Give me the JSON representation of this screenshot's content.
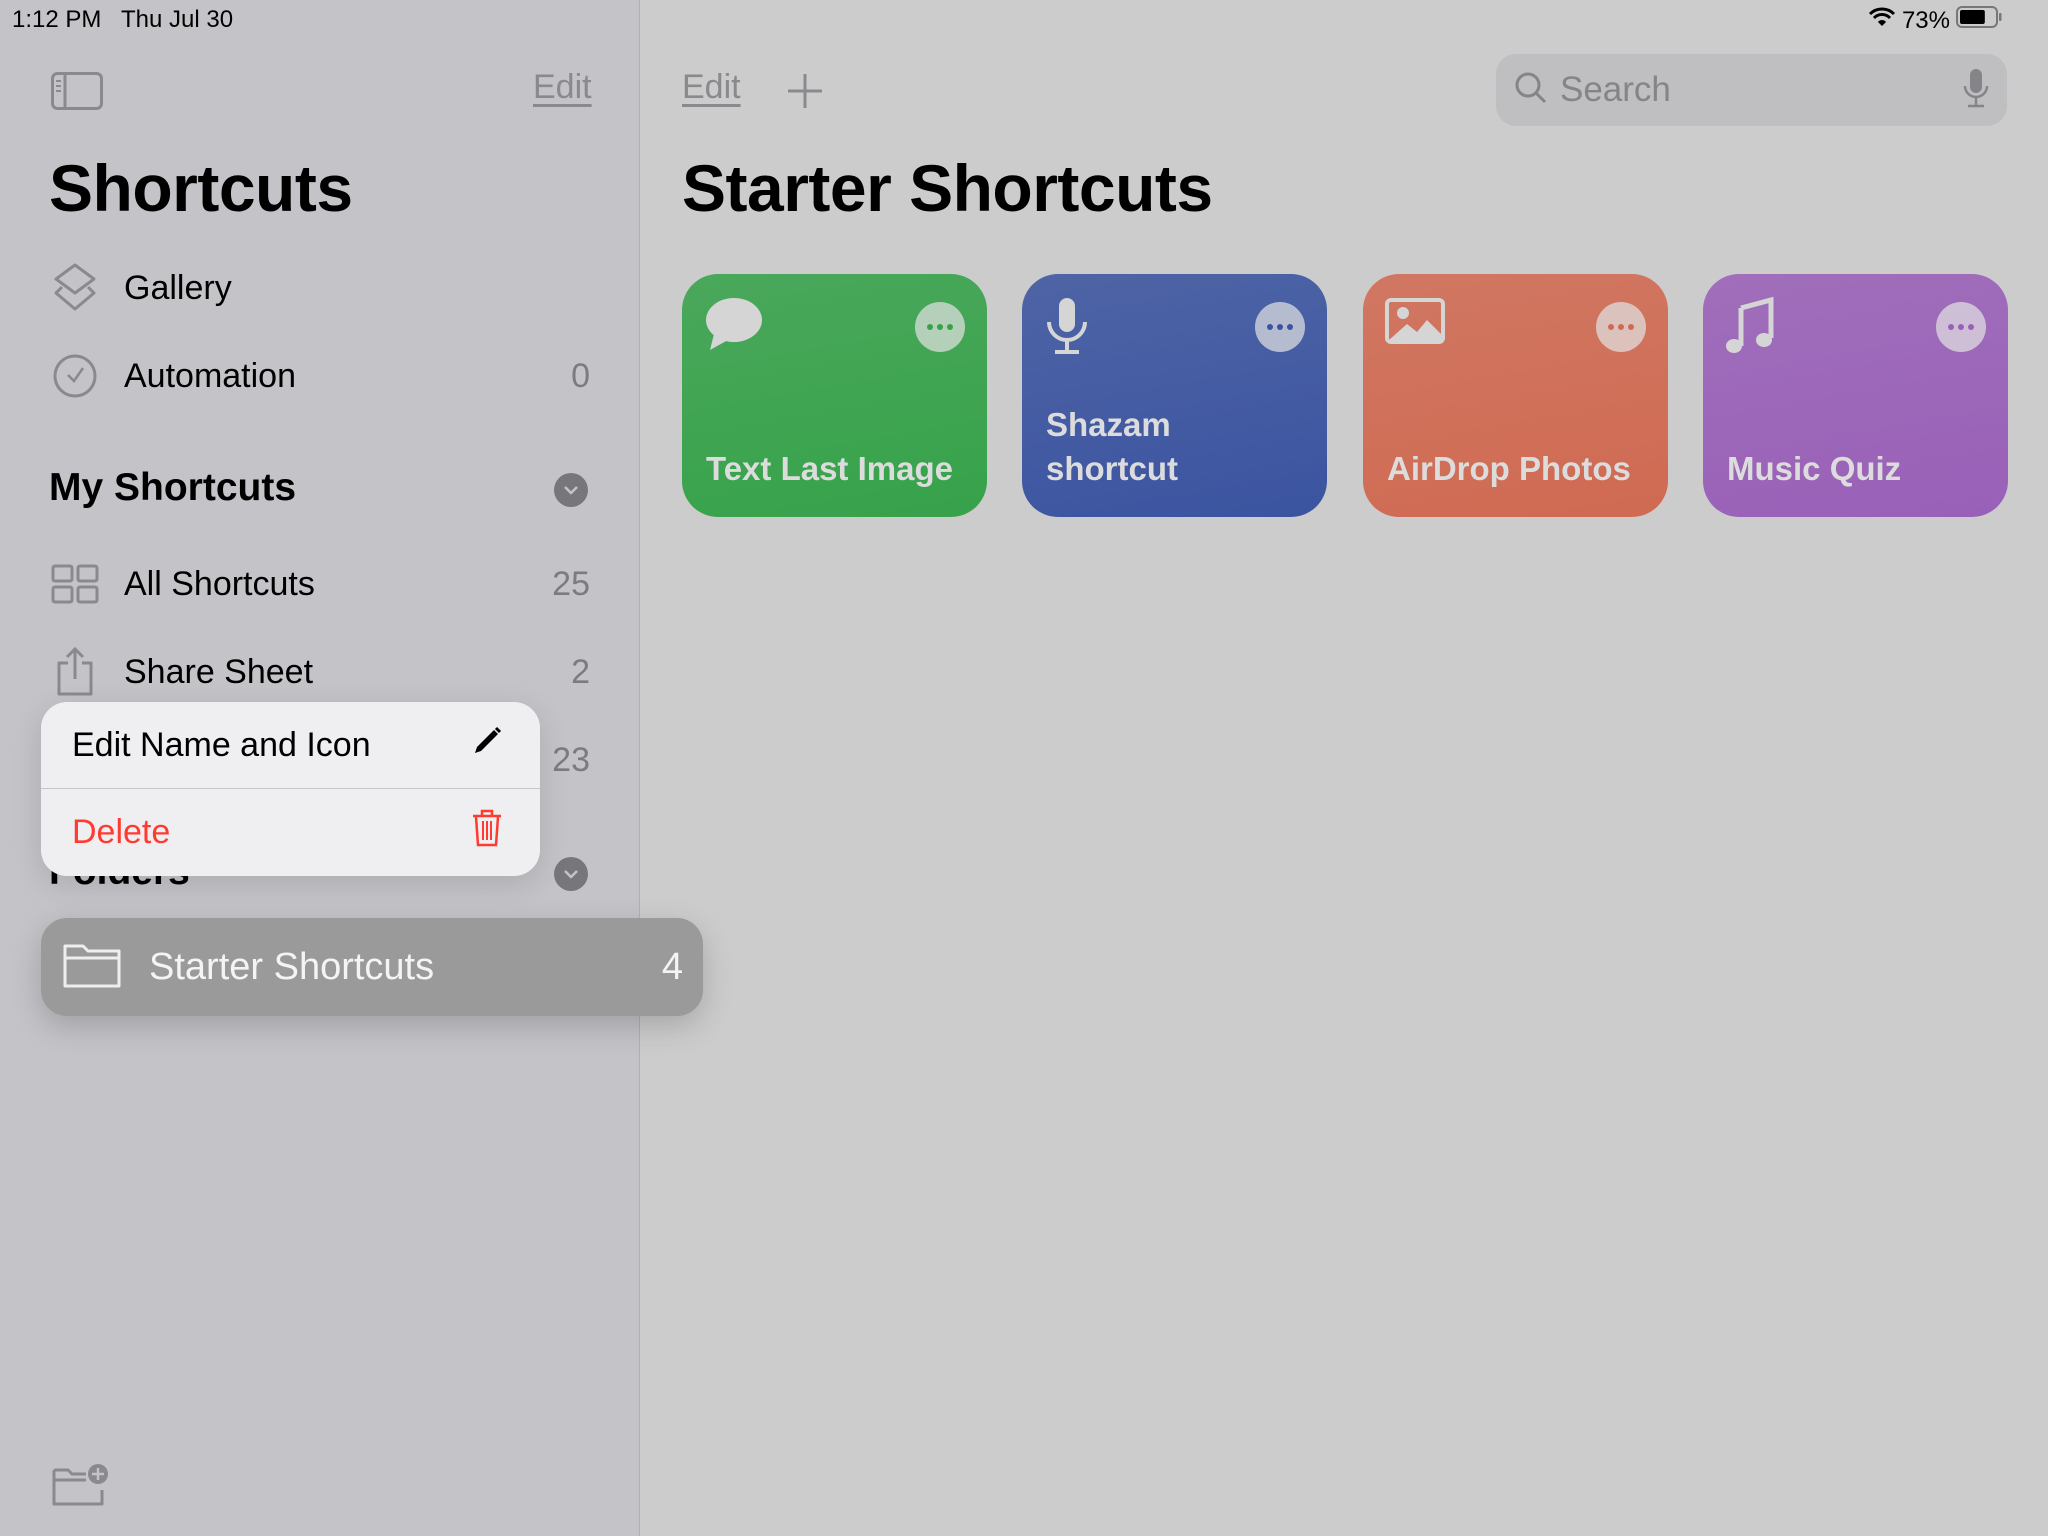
{
  "status_bar": {
    "time": "1:12 PM",
    "date": "Thu Jul 30",
    "battery": "73%",
    "battery_level": 0.73
  },
  "sidebar": {
    "edit_label": "Edit",
    "title": "Shortcuts",
    "items": [
      {
        "label": "Gallery",
        "count": "",
        "icon": "gallery-icon"
      },
      {
        "label": "Automation",
        "count": "0",
        "icon": "clock-check-icon"
      }
    ],
    "my_shortcuts": {
      "header": "My Shortcuts",
      "items": [
        {
          "label": "All Shortcuts",
          "count": "25",
          "icon": "grid-icon"
        },
        {
          "label": "Share Sheet",
          "count": "2",
          "icon": "share-icon"
        },
        {
          "label": "",
          "count": "23"
        }
      ]
    },
    "folders": {
      "header": "Folders"
    },
    "lifted_folder": {
      "label": "Starter Shortcuts",
      "count": "4"
    }
  },
  "context_menu": {
    "items": [
      {
        "label": "Edit Name and Icon",
        "icon": "pencil-icon",
        "color": "#000000"
      },
      {
        "label": "Delete",
        "icon": "trash-icon",
        "color": "#ff3b30"
      }
    ]
  },
  "main": {
    "edit_label": "Edit",
    "search_placeholder": "Search",
    "title": "Starter Shortcuts",
    "cards": [
      {
        "name": "Text Last Image",
        "icon": "message-bubble-icon",
        "color": "#36a24a"
      },
      {
        "name": "Shazam shortcut",
        "icon": "microphone-icon",
        "color": "#3b54a0"
      },
      {
        "name": "AirDrop Photos",
        "icon": "photo-icon",
        "color": "#d06a52"
      },
      {
        "name": "Music Quiz",
        "icon": "music-note-icon",
        "color": "#9960b8"
      }
    ]
  }
}
